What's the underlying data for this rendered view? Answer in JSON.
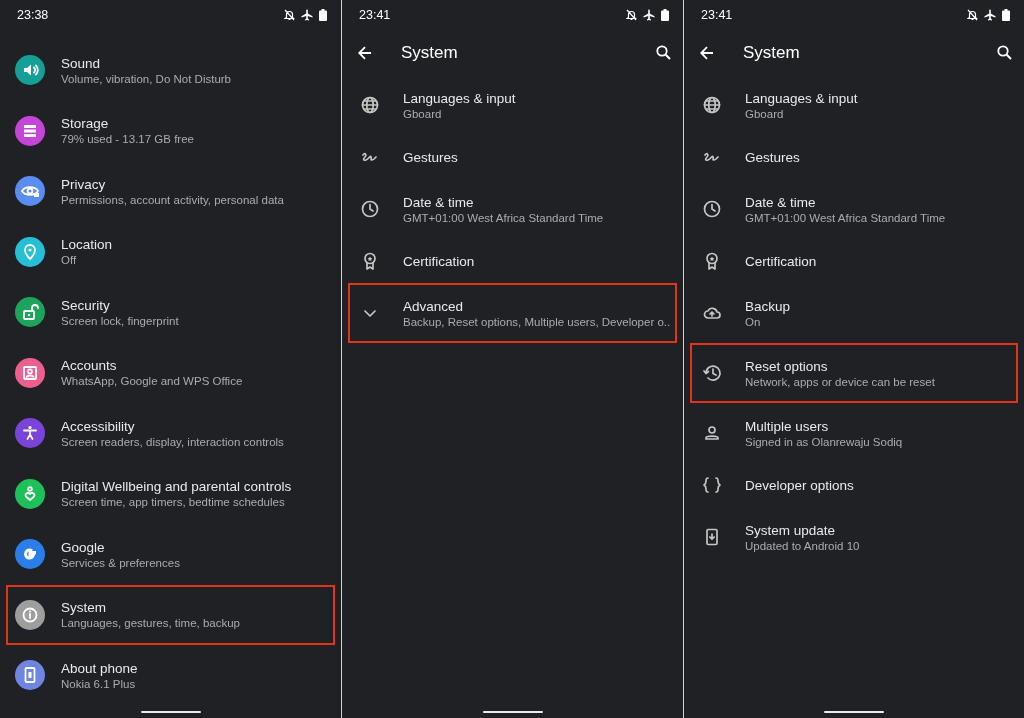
{
  "screens": [
    {
      "status_bar": {
        "time": "23:38"
      },
      "items": [
        {
          "title": "Sound",
          "subtitle": "Volume, vibration, Do Not Disturb",
          "color": "#15a097",
          "highlighted": false
        },
        {
          "title": "Storage",
          "subtitle": "79% used - 13.17 GB free",
          "color": "#c545d8",
          "highlighted": false
        },
        {
          "title": "Privacy",
          "subtitle": "Permissions, account activity, personal data",
          "color": "#5a8df0",
          "highlighted": false
        },
        {
          "title": "Location",
          "subtitle": "Off",
          "color": "#26bfd6",
          "highlighted": false
        },
        {
          "title": "Security",
          "subtitle": "Screen lock, fingerprint",
          "color": "#1ea35c",
          "highlighted": false
        },
        {
          "title": "Accounts",
          "subtitle": "WhatsApp, Google and WPS Office",
          "color": "#ed5f8e",
          "highlighted": false
        },
        {
          "title": "Accessibility",
          "subtitle": "Screen readers, display, interaction controls",
          "color": "#7b44d8",
          "highlighted": false
        },
        {
          "title": "Digital Wellbeing and parental controls",
          "subtitle": "Screen time, app timers, bedtime schedules",
          "color": "#1ec05a",
          "highlighted": false
        },
        {
          "title": "Google",
          "subtitle": "Services & preferences",
          "color": "#2b7de9",
          "highlighted": false
        },
        {
          "title": "System",
          "subtitle": "Languages, gestures, time, backup",
          "color": "#9e9e9e",
          "highlighted": true
        },
        {
          "title": "About phone",
          "subtitle": "Nokia 6.1 Plus",
          "color": "#6e86e2",
          "highlighted": false
        }
      ]
    },
    {
      "status_bar": {
        "time": "23:41"
      },
      "toolbar": {
        "title": "System"
      },
      "items": [
        {
          "title": "Languages & input",
          "subtitle": "Gboard",
          "highlighted": false
        },
        {
          "title": "Gestures",
          "highlighted": false
        },
        {
          "title": "Date & time",
          "subtitle": "GMT+01:00 West Africa Standard Time",
          "highlighted": false
        },
        {
          "title": "Certification",
          "highlighted": false
        },
        {
          "title": "Advanced",
          "subtitle": "Backup, Reset options, Multiple users, Developer o..",
          "highlighted": true
        }
      ]
    },
    {
      "status_bar": {
        "time": "23:41"
      },
      "toolbar": {
        "title": "System"
      },
      "items": [
        {
          "title": "Languages & input",
          "subtitle": "Gboard",
          "highlighted": false
        },
        {
          "title": "Gestures",
          "highlighted": false
        },
        {
          "title": "Date & time",
          "subtitle": "GMT+01:00 West Africa Standard Time",
          "highlighted": false
        },
        {
          "title": "Certification",
          "highlighted": false
        },
        {
          "title": "Backup",
          "subtitle": "On",
          "highlighted": false
        },
        {
          "title": "Reset options",
          "subtitle": "Network, apps or device can be reset",
          "highlighted": true
        },
        {
          "title": "Multiple users",
          "subtitle": "Signed in as Olanrewaju Sodiq",
          "highlighted": false
        },
        {
          "title": "Developer options",
          "highlighted": false
        },
        {
          "title": "System update",
          "subtitle": "Updated to Android 10",
          "highlighted": false
        }
      ]
    }
  ]
}
